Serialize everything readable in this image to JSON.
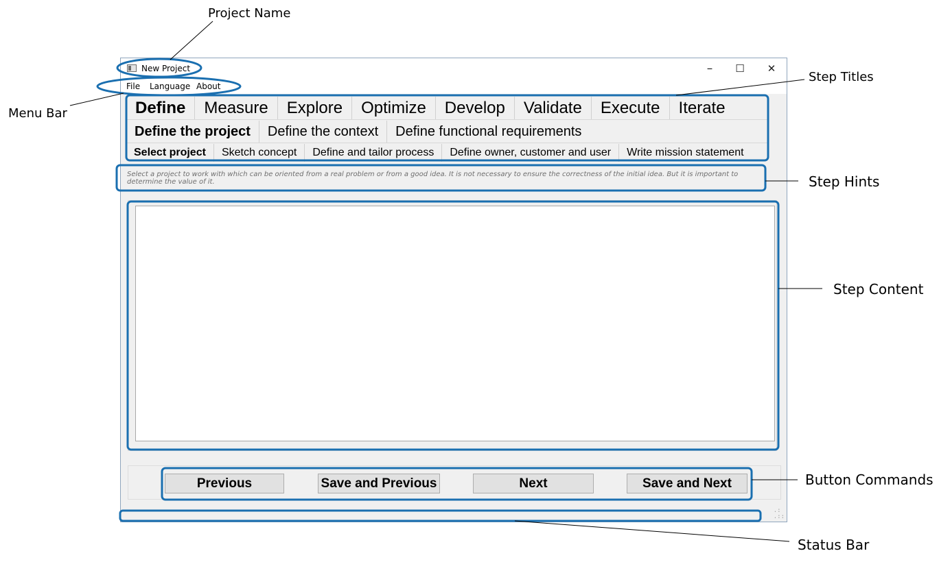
{
  "annotations": {
    "project_name": "Project Name",
    "menu_bar": "Menu Bar",
    "step_titles": "Step Titles",
    "step_hints": "Step Hints",
    "step_content": "Step Content",
    "button_commands": "Button Commands",
    "status_bar": "Status Bar"
  },
  "window": {
    "title": "New Project",
    "controls": {
      "minimize": "–",
      "maximize": "☐",
      "close": "✕"
    }
  },
  "menu": [
    "File",
    "Language",
    "About"
  ],
  "steps": {
    "level1": [
      {
        "label": "Define",
        "active": true
      },
      {
        "label": "Measure"
      },
      {
        "label": "Explore"
      },
      {
        "label": "Optimize"
      },
      {
        "label": "Develop"
      },
      {
        "label": "Validate"
      },
      {
        "label": "Execute"
      },
      {
        "label": "Iterate"
      }
    ],
    "level2": [
      {
        "label": "Define the project",
        "active": true
      },
      {
        "label": "Define the context"
      },
      {
        "label": "Define functional requirements"
      }
    ],
    "level3": [
      {
        "label": "Select project",
        "active": true
      },
      {
        "label": "Sketch concept"
      },
      {
        "label": "Define and tailor process"
      },
      {
        "label": "Define owner, customer and user"
      },
      {
        "label": "Write mission statement"
      }
    ]
  },
  "hint": "Select a project to work with which can be oriented from a real problem or from a good idea. It is not necessary to ensure the correctness of the initial idea. But it is important to determine the value of it.",
  "content": {
    "value": ""
  },
  "buttons": {
    "previous": "Previous",
    "save_previous": "Save and Previous",
    "next": "Next",
    "save_next": "Save and Next"
  },
  "status": {
    "text": ""
  },
  "colors": {
    "annotation": "#1a6fb0",
    "window_bg": "#f0f0f0",
    "button_bg": "#e1e1e1"
  }
}
